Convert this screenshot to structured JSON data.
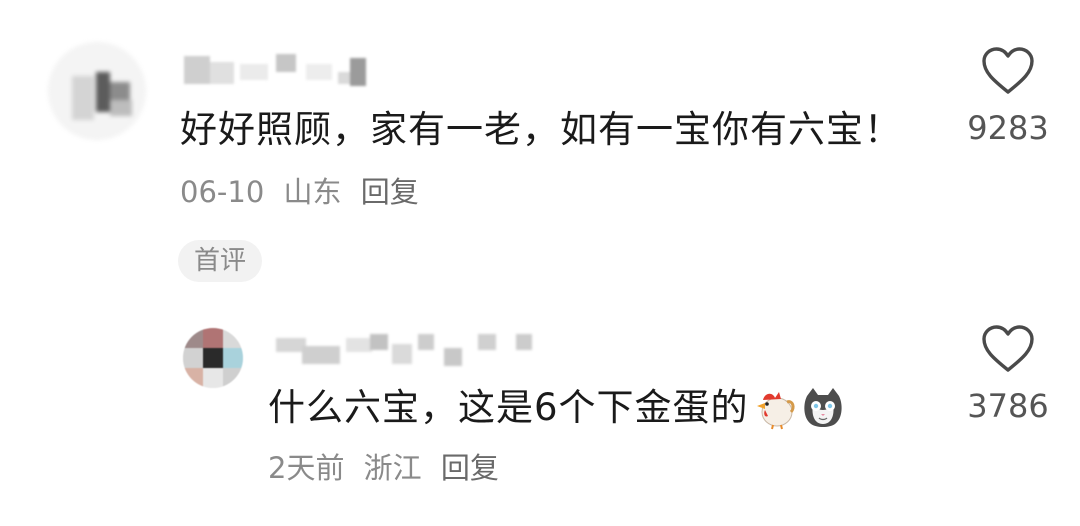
{
  "comments": [
    {
      "text": "好好照顾，家有一老，如有一宝你有六宝！",
      "date": "06-10",
      "location": "山东",
      "reply_label": "回复",
      "badge": "首评",
      "likes": "9283",
      "like_icon": "heart-outline-icon"
    }
  ],
  "replies": [
    {
      "text": "什么六宝，这是6个下金蛋的",
      "emojis": [
        "chicken-emoji",
        "cat-face-emoji"
      ],
      "date": "2天前",
      "location": "浙江",
      "reply_label": "回复",
      "likes": "3786",
      "like_icon": "heart-outline-icon"
    }
  ],
  "colors": {
    "text_primary": "#1a1a1a",
    "text_meta": "#8a8a8a",
    "badge_bg": "#f2f2f2",
    "heart_stroke": "#4a4a4a"
  }
}
